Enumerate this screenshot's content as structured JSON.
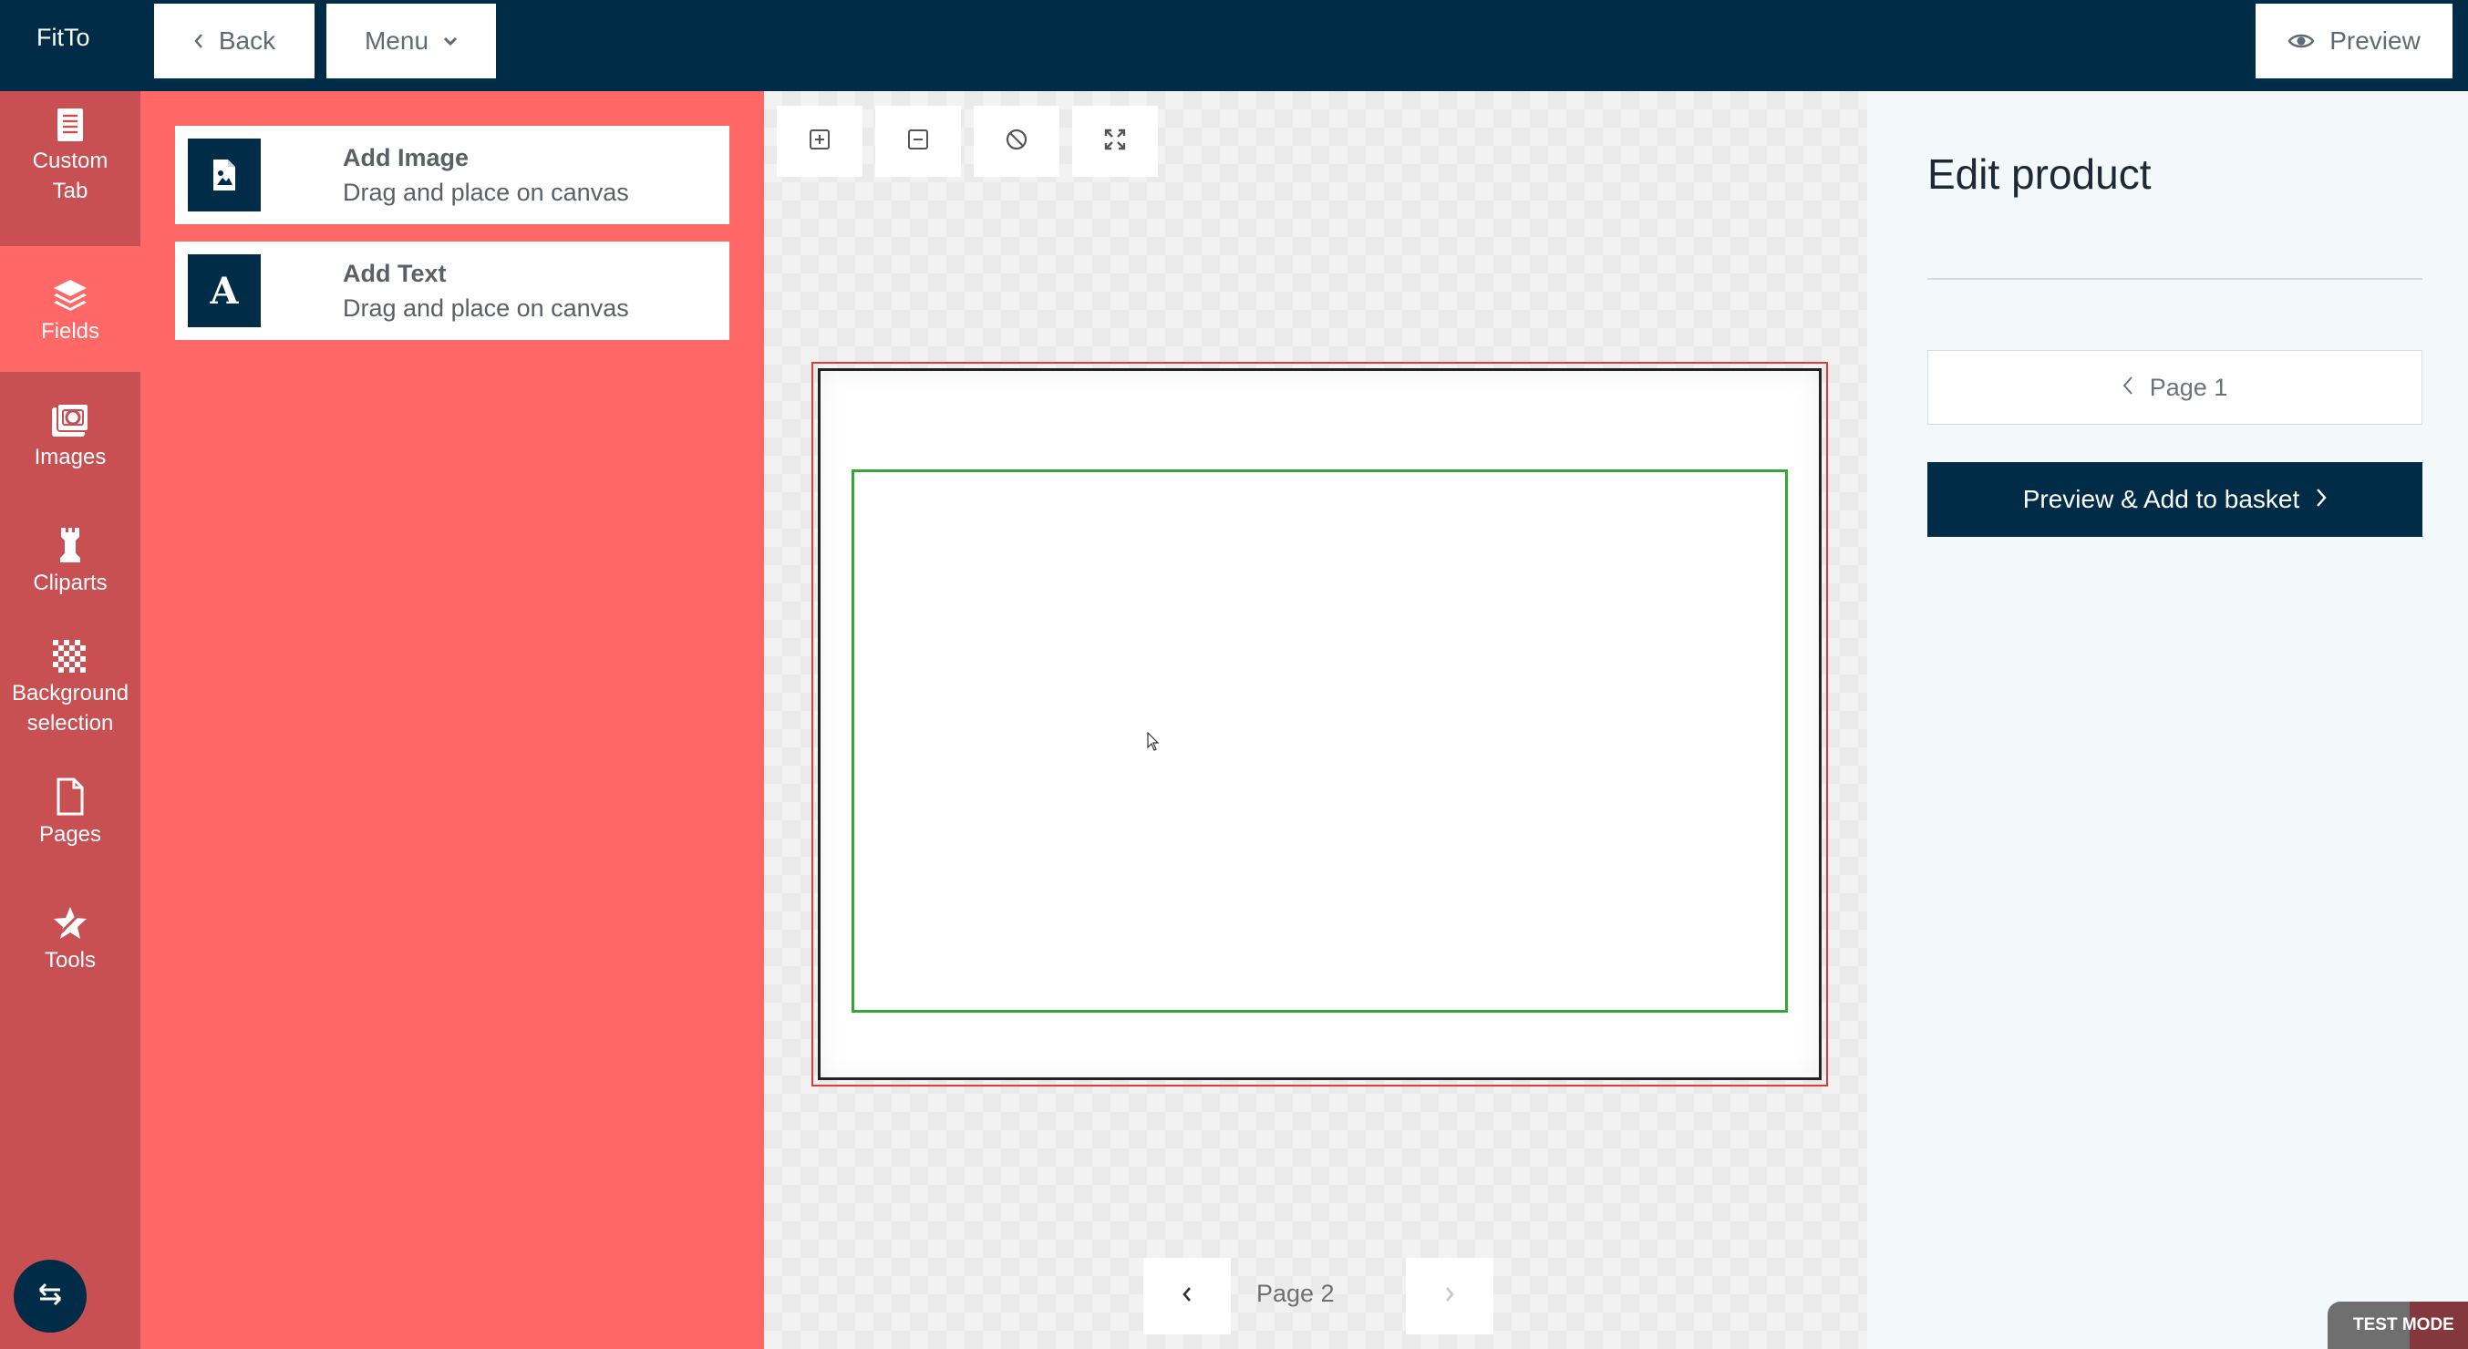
{
  "header": {
    "brand": "FitTo",
    "back_label": "Back",
    "menu_label": "Menu",
    "preview_label": "Preview"
  },
  "sidebar": {
    "items": [
      {
        "label_line1": "Custom",
        "label_line2": "Tab",
        "icon": "list-icon"
      },
      {
        "label_line1": "Fields",
        "label_line2": "",
        "icon": "layers-icon",
        "active": true
      },
      {
        "label_line1": "Images",
        "label_line2": "",
        "icon": "images-icon"
      },
      {
        "label_line1": "Cliparts",
        "label_line2": "",
        "icon": "chess-rook-icon"
      },
      {
        "label_line1": "Background",
        "label_line2": "selection",
        "icon": "checker-icon"
      },
      {
        "label_line1": "Pages",
        "label_line2": "",
        "icon": "page-icon"
      },
      {
        "label_line1": "Tools",
        "label_line2": "",
        "icon": "tools-icon"
      }
    ]
  },
  "fields_panel": {
    "cards": [
      {
        "title": "Add Image",
        "subtitle": "Drag and place on canvas",
        "icon": "image-file-icon"
      },
      {
        "title": "Add Text",
        "subtitle": "Drag and place on canvas",
        "icon": "text-A-icon",
        "glyph": "A"
      }
    ]
  },
  "canvas": {
    "page_label": "Page 2"
  },
  "editor": {
    "title": "Edit product",
    "page_nav_label": "Page 1",
    "basket_button_label": "Preview & Add to basket"
  },
  "footer": {
    "test_mode_label": "TEST MODE"
  },
  "colors": {
    "navy": "#002c48",
    "coral": "#ff6866",
    "rail": "#c84f52",
    "bleed": "#e03a3a",
    "safe": "#3aa335"
  }
}
